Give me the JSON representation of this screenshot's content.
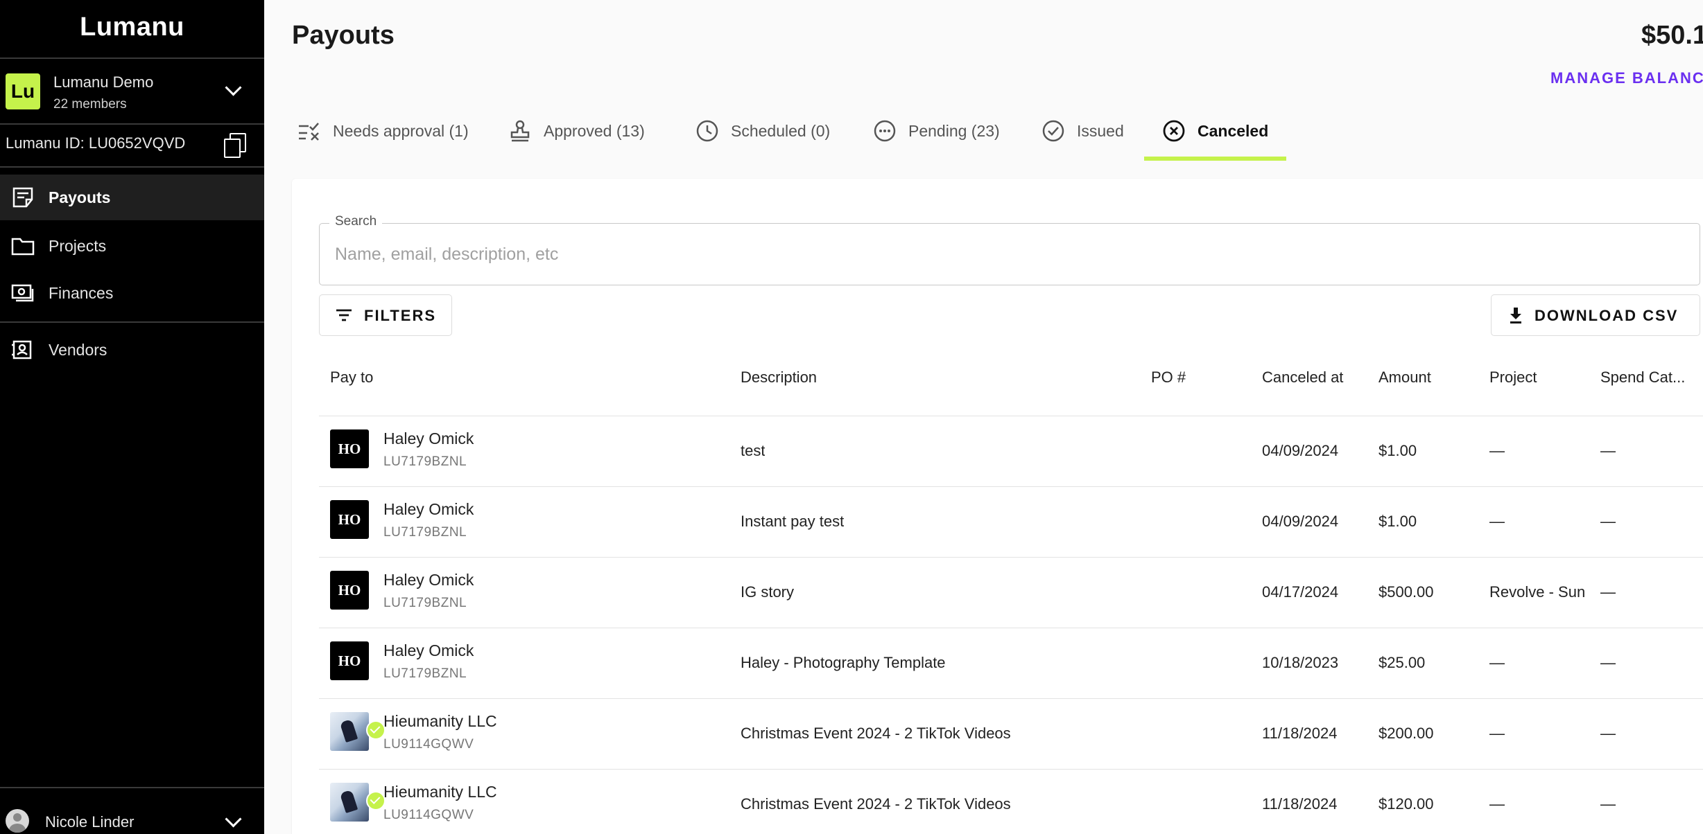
{
  "sidebar": {
    "logo": "Lumanu",
    "org": {
      "badge": "Lu",
      "name": "Lumanu Demo",
      "members": "22 members"
    },
    "lumanu_id": "Lumanu ID: LU0652VQVD",
    "nav": [
      {
        "label": "Payouts",
        "icon": "payouts-icon"
      },
      {
        "label": "Projects",
        "icon": "folder-icon"
      },
      {
        "label": "Finances",
        "icon": "cash-icon"
      },
      {
        "label": "Vendors",
        "icon": "vendors-icon"
      }
    ],
    "user": {
      "name": "Nicole Linder"
    }
  },
  "header": {
    "title": "Payouts",
    "balance": "$50.1",
    "manage_label": "MANAGE BALANCE"
  },
  "tabs": [
    {
      "label": "Needs approval (1)",
      "icon": "checklist-icon"
    },
    {
      "label": "Approved (13)",
      "icon": "stamp-icon"
    },
    {
      "label": "Scheduled (0)",
      "icon": "clock-icon"
    },
    {
      "label": "Pending (23)",
      "icon": "more-circle-icon"
    },
    {
      "label": "Issued",
      "icon": "check-circle-icon"
    },
    {
      "label": "Canceled",
      "icon": "cancel-circle-icon",
      "active": true
    }
  ],
  "search": {
    "label": "Search",
    "placeholder": "Name, email, description, etc",
    "value": ""
  },
  "filters_label": "FILTERS",
  "download_label": "DOWNLOAD CSV",
  "table": {
    "columns": [
      "Pay to",
      "Description",
      "PO #",
      "Canceled at",
      "Amount",
      "Project",
      "Spend Cat..."
    ],
    "rows": [
      {
        "initials": "HO",
        "name": "Haley Omick",
        "id": "LU7179BZNL",
        "description": "test",
        "po": "",
        "canceled_at": "04/09/2024",
        "amount": "$1.00",
        "project": "—",
        "spend": "—"
      },
      {
        "initials": "HO",
        "name": "Haley Omick",
        "id": "LU7179BZNL",
        "description": "Instant pay test",
        "po": "",
        "canceled_at": "04/09/2024",
        "amount": "$1.00",
        "project": "—",
        "spend": "—"
      },
      {
        "initials": "HO",
        "name": "Haley Omick",
        "id": "LU7179BZNL",
        "description": "IG story",
        "po": "",
        "canceled_at": "04/17/2024",
        "amount": "$500.00",
        "project": "Revolve - Sun",
        "spend": "—"
      },
      {
        "initials": "HO",
        "name": "Haley Omick",
        "id": "LU7179BZNL",
        "description": "Haley - Photography Template",
        "po": "",
        "canceled_at": "10/18/2023",
        "amount": "$25.00",
        "project": "—",
        "spend": "—"
      },
      {
        "initials": "",
        "name": "Hieumanity LLC",
        "id": "LU9114GQWV",
        "description": "Christmas Event 2024 - 2 TikTok Videos",
        "po": "",
        "canceled_at": "11/18/2024",
        "amount": "$200.00",
        "project": "—",
        "spend": "—"
      },
      {
        "initials": "",
        "name": "Hieumanity LLC",
        "id": "LU9114GQWV",
        "description": "Christmas Event 2024 - 2 TikTok Videos",
        "po": "",
        "canceled_at": "11/18/2024",
        "amount": "$120.00",
        "project": "—",
        "spend": "—"
      }
    ]
  },
  "colors": {
    "accent": "#c5f24b",
    "link": "#6a2ff0",
    "sidebar": "#000000"
  }
}
